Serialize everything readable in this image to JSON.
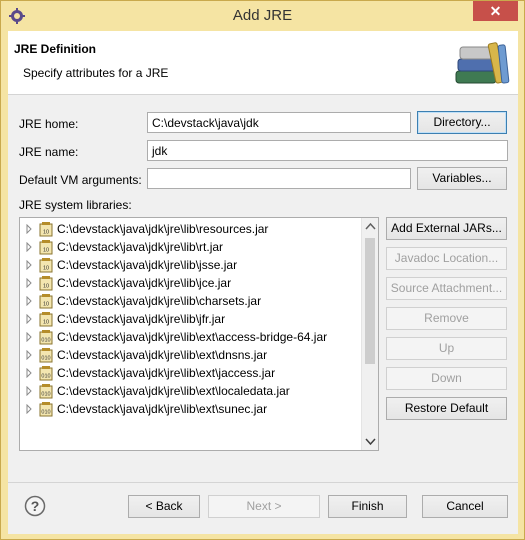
{
  "window": {
    "title": "Add JRE",
    "close_symbol": "✕"
  },
  "header": {
    "title": "JRE Definition",
    "description": "Specify attributes for a JRE"
  },
  "form": {
    "jre_home_label": "JRE home:",
    "jre_home_value": "C:\\devstack\\java\\jdk",
    "directory_button": "Directory...",
    "jre_name_label": "JRE name:",
    "jre_name_value": "jdk",
    "vm_args_label": "Default VM arguments:",
    "vm_args_value": "",
    "variables_button": "Variables...",
    "libraries_label": "JRE system libraries:"
  },
  "libraries": [
    "C:\\devstack\\java\\jdk\\jre\\lib\\resources.jar",
    "C:\\devstack\\java\\jdk\\jre\\lib\\rt.jar",
    "C:\\devstack\\java\\jdk\\jre\\lib\\jsse.jar",
    "C:\\devstack\\java\\jdk\\jre\\lib\\jce.jar",
    "C:\\devstack\\java\\jdk\\jre\\lib\\charsets.jar",
    "C:\\devstack\\java\\jdk\\jre\\lib\\jfr.jar",
    "C:\\devstack\\java\\jdk\\jre\\lib\\ext\\access-bridge-64.jar",
    "C:\\devstack\\java\\jdk\\jre\\lib\\ext\\dnsns.jar",
    "C:\\devstack\\java\\jdk\\jre\\lib\\ext\\jaccess.jar",
    "C:\\devstack\\java\\jdk\\jre\\lib\\ext\\localedata.jar",
    "C:\\devstack\\java\\jdk\\jre\\lib\\ext\\sunec.jar"
  ],
  "library_icon_labels": [
    "10",
    "10",
    "10",
    "10",
    "10",
    "10",
    "010",
    "010",
    "010",
    "010",
    "010"
  ],
  "side_buttons": {
    "add_external_jars": "Add External JARs...",
    "javadoc_location": "Javadoc Location...",
    "source_attachment": "Source Attachment...",
    "remove": "Remove",
    "up": "Up",
    "down": "Down",
    "restore_default": "Restore Default"
  },
  "footer": {
    "help_symbol": "?",
    "back": "< Back",
    "next": "Next >",
    "finish": "Finish",
    "cancel": "Cancel"
  },
  "colors": {
    "window_frame": "#f5e4a3",
    "close_button": "#c7504a",
    "focus_border": "#3c7fb1"
  }
}
